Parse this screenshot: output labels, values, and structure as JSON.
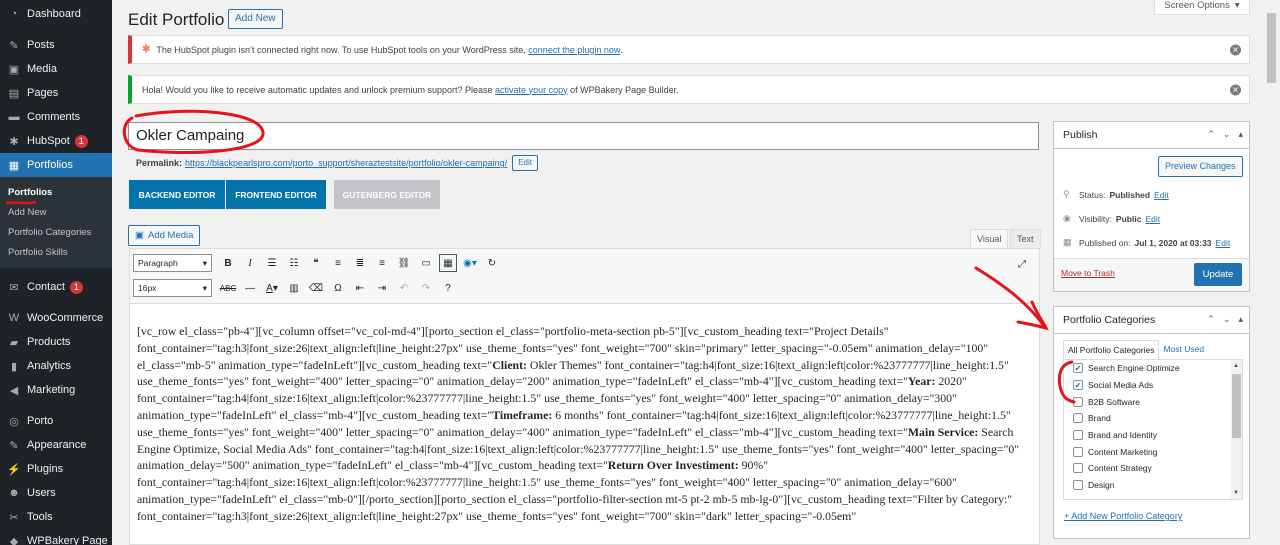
{
  "sidebar": {
    "items": [
      {
        "label": "Dashboard",
        "icon": "dashboard-icon",
        "glyph": "◔"
      },
      {
        "label": "Posts",
        "icon": "pin-icon",
        "glyph": "✎"
      },
      {
        "label": "Media",
        "icon": "media-icon",
        "glyph": "▣"
      },
      {
        "label": "Pages",
        "icon": "pages-icon",
        "glyph": "▤"
      },
      {
        "label": "Comments",
        "icon": "comments-icon",
        "glyph": "▬"
      },
      {
        "label": "HubSpot",
        "icon": "hubspot-icon",
        "glyph": "✱",
        "badge": "1"
      },
      {
        "label": "Portfolios",
        "icon": "portfolio-icon",
        "glyph": "▦"
      },
      {
        "label": "Contact",
        "icon": "mail-icon",
        "glyph": "✉",
        "badge": "1"
      },
      {
        "label": "WooCommerce",
        "icon": "woo-icon",
        "glyph": "W"
      },
      {
        "label": "Products",
        "icon": "products-icon",
        "glyph": "▰"
      },
      {
        "label": "Analytics",
        "icon": "analytics-icon",
        "glyph": "▮"
      },
      {
        "label": "Marketing",
        "icon": "megaphone-icon",
        "glyph": "◀"
      },
      {
        "label": "Porto",
        "icon": "porto-icon",
        "glyph": "◎"
      },
      {
        "label": "Appearance",
        "icon": "brush-icon",
        "glyph": "✎"
      },
      {
        "label": "Plugins",
        "icon": "plugin-icon",
        "glyph": "⚡"
      },
      {
        "label": "Users",
        "icon": "users-icon",
        "glyph": "☻"
      },
      {
        "label": "Tools",
        "icon": "wrench-icon",
        "glyph": "✂"
      },
      {
        "label": "WPBakery Page",
        "icon": "wpbakery-icon",
        "glyph": "◆"
      }
    ],
    "submenu": [
      "Portfolios",
      "Add New",
      "Portfolio Categories",
      "Portfolio Skills"
    ]
  },
  "header": {
    "title": "Edit Portfolio",
    "add_new": "Add New",
    "screen_options": "Screen Options"
  },
  "notices": {
    "hubspot_text": "The HubSpot plugin isn’t connected right now. To use HubSpot tools on your WordPress site,",
    "hubspot_link": "connect the plugin now",
    "hubspot_end": ".",
    "wpbakery_text": "Hola! Would you like to receive automatic updates and unlock premium support? Please",
    "wpbakery_link": "activate your copy",
    "wpbakery_end": "of WPBakery Page Builder."
  },
  "post": {
    "title": "Okler Campaing",
    "permalink_label": "Permalink:",
    "permalink_url": "https://blackpearlspro.com/porto_support/sheraztestsite/portfolio/okler-campaing/",
    "permalink_edit": "Edit"
  },
  "editor_buttons": {
    "backend": "BACKEND EDITOR",
    "frontend": "FRONTEND EDITOR",
    "gutenberg": "GUTENBERG EDITOR"
  },
  "editor": {
    "add_media": "Add Media",
    "tab_visual": "Visual",
    "tab_text": "Text",
    "format_select": "Paragraph",
    "font_size_select": "16px",
    "content": [
      {
        "t": "[vc_row el_class=\"pb-4\"][vc_column offset=\"vc_col-md-4\"][porto_section el_class=\"portfolio-meta-section pb-5\"][vc_custom_heading text=\"Project Details\" font_container=\"tag:h3|font_size:26|text_align:left|line_height:27px\" use_theme_fonts=\"yes\" font_weight=\"700\" skin=\"primary\" letter_spacing=\"-0.05em\" animation_delay=\"100\" el_class=\"mb-5\" animation_type=\"fadeInLeft\"][vc_custom_heading text=\"",
        "b": "Client:"
      },
      {
        "t": " Okler Themes\" font_container=\"tag:h4|font_size:16|text_align:left|color:%23777777|line_height:1.5\" use_theme_fonts=\"yes\" font_weight=\"400\" letter_spacing=\"0\" animation_delay=\"200\" animation_type=\"fadeInLeft\" el_class=\"mb-4\"][vc_custom_heading text=\"",
        "b": "Year:"
      },
      {
        "t": " 2020\" font_container=\"tag:h4|font_size:16|text_align:left|color:%23777777|line_height:1.5\" use_theme_fonts=\"yes\" font_weight=\"400\" letter_spacing=\"0\" animation_delay=\"300\" animation_type=\"fadeInLeft\" el_class=\"mb-4\"][vc_custom_heading text=\"",
        "b": "Timeframe:"
      },
      {
        "t": " 6 months\" font_container=\"tag:h4|font_size:16|text_align:left|color:%23777777|line_height:1.5\" use_theme_fonts=\"yes\" font_weight=\"400\" letter_spacing=\"0\" animation_delay=\"400\" animation_type=\"fadeInLeft\" el_class=\"mb-4\"][vc_custom_heading text=\"",
        "b": "Main Service:"
      },
      {
        "t": " Search Engine Optimize, Social Media Ads\" font_container=\"tag:h4|font_size:16|text_align:left|color:%23777777|line_height:1.5\" use_theme_fonts=\"yes\" font_weight=\"400\" letter_spacing=\"0\" animation_delay=\"500\" animation_type=\"fadeInLeft\" el_class=\"mb-4\"][vc_custom_heading text=\"",
        "b": "Return Over Investiment:"
      },
      {
        "t": " 90%\" font_container=\"tag:h4|font_size:16|text_align:left|color:%23777777|line_height:1.5\" use_theme_fonts=\"yes\" font_weight=\"400\" letter_spacing=\"0\" animation_delay=\"600\" animation_type=\"fadeInLeft\" el_class=\"mb-0\"][/porto_section][porto_section el_class=\"portfolio-filter-section mt-5 pt-2 mb-5 mb-lg-0\"][vc_custom_heading text=\"Filter by Category:\" font_container=\"tag:h3|font_size:26|text_align:left|line_height:27px\" use_theme_fonts=\"yes\" font_weight=\"700\" skin=\"dark\" letter_spacing=\"-0.05em\"",
        "b": ""
      }
    ]
  },
  "publish": {
    "title": "Publish",
    "preview": "Preview Changes",
    "status_label": "Status:",
    "status_value": "Published",
    "status_edit": "Edit",
    "visibility_label": "Visibility:",
    "visibility_value": "Public",
    "visibility_edit": "Edit",
    "date_label": "Published on:",
    "date_value": "Jul 1, 2020 at 03:33",
    "date_edit": "Edit",
    "trash": "Move to Trash",
    "update": "Update"
  },
  "categories": {
    "title": "Portfolio Categories",
    "tab_all": "All Portfolio Categories",
    "tab_most_used": "Most Used",
    "items": [
      {
        "label": "Search Engine Optimize",
        "checked": true
      },
      {
        "label": "Social Media Ads",
        "checked": true
      },
      {
        "label": "B2B Software",
        "checked": false
      },
      {
        "label": "Brand",
        "checked": false
      },
      {
        "label": "Brand and Identity",
        "checked": false
      },
      {
        "label": "Content Marketing",
        "checked": false
      },
      {
        "label": "Content Strategy",
        "checked": false
      },
      {
        "label": "Design",
        "checked": false
      }
    ],
    "add_link": "+ Add New Portfolio Category"
  },
  "colors": {
    "accent": "#2271b1",
    "sidebar_bg": "#1d2327",
    "annotation_red": "#e8121b",
    "wpbakery_blue": "#0473aa"
  }
}
